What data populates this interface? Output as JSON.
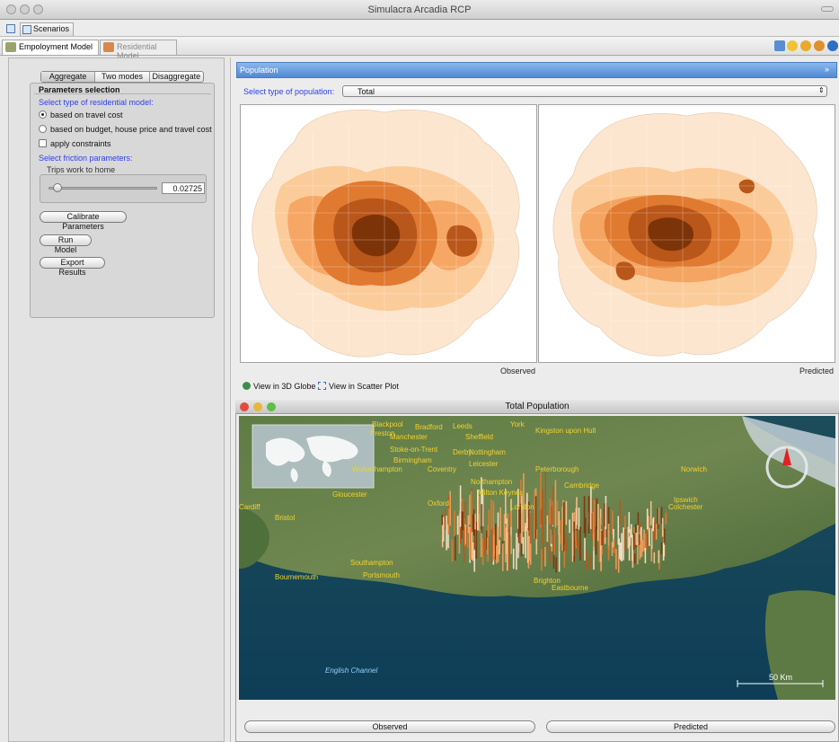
{
  "window": {
    "title": "Simulacra Arcadia RCP"
  },
  "scenarios_tab": {
    "label": "Scenarios"
  },
  "model_tabs": [
    {
      "label": "Empoloyment Model",
      "active": true
    },
    {
      "label": "Residential Model",
      "active": false
    }
  ],
  "mode_tabs": [
    "Aggregate",
    "Two modes",
    "Disaggregate"
  ],
  "parameters": {
    "title": "Parameters selection",
    "model_type_label": "Select type of residential model:",
    "options": [
      {
        "label": "based on travel cost",
        "selected": true
      },
      {
        "label": "based on budget, house price and travel cost",
        "selected": false
      }
    ],
    "constraints_label": "apply constraints",
    "friction_label": "Select friction parameters:",
    "trips_label": "Trips work to home",
    "trips_value": "0.02725",
    "trips_slider_fraction": 0.05
  },
  "buttons": {
    "calibrate": "Calibrate Parameters",
    "run": "Run Model",
    "export": "Export Results"
  },
  "population_panel": {
    "title": "Population",
    "close_glyph": "»",
    "select_label": "Select type of population:",
    "select_value": "Total",
    "select_arrow": "⇕",
    "observed_caption": "Observed",
    "predicted_caption": "Predicted"
  },
  "links": {
    "globe": "View in 3D Globe",
    "scatter": "View in Scatter Plot"
  },
  "globe_window": {
    "title": "Total Population",
    "places": [
      "Blackpool",
      "York",
      "Kingston upon Hull",
      "Preston",
      "Bradford",
      "Leeds",
      "Manchester",
      "Sheffield",
      "Stoke-on-Trent",
      "Derby",
      "Nottingham",
      "Leicester",
      "Peterborough",
      "Norwich",
      "Birmingham",
      "Coventry",
      "Wolverhampton",
      "Northampton",
      "Cambridge",
      "Ipswich",
      "Gloucester",
      "Milton Keynes",
      "Colchester",
      "Cardiff",
      "Bristol",
      "Oxford",
      "London",
      "Southampton",
      "Portsmouth",
      "Brighton",
      "Eastbourne",
      "Bournemouth",
      "English Channel"
    ],
    "scale_label": "50 Km"
  },
  "bottom_buttons": {
    "observed": "Observed",
    "predicted": "Predicted"
  },
  "colors": {
    "choropleth": [
      "#fde6cf",
      "#fbc893",
      "#f4a15c",
      "#e07a31",
      "#b9561a",
      "#7d3308"
    ],
    "header_blue": "#5b93d9",
    "label_blue": "#2d3fe8",
    "place_label": "#f1d32e"
  }
}
